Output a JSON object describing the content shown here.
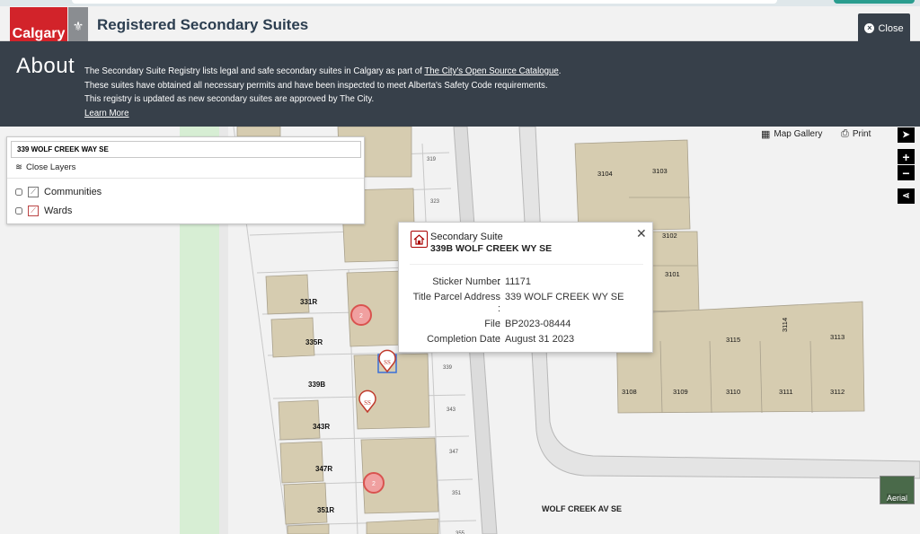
{
  "header": {
    "logo_text": "Calgary",
    "title": "Registered Secondary Suites",
    "close_label": "Close"
  },
  "about": {
    "heading": "About",
    "line1_a": "The Secondary Suite Registry lists legal and safe secondary suites in Calgary as part of ",
    "line1_link": "The City's Open Source Catalogue",
    "line1_b": ".",
    "line2": "These suites have obtained all necessary permits and have been inspected to meet Alberta's Safety Code requirements.",
    "line3": "This registry is updated as new secondary suites are approved by The City.",
    "learn_more": "Learn More"
  },
  "layers": {
    "search_value": "339 WOLF CREEK WAY SE",
    "close_label": "Close Layers",
    "items": [
      {
        "label": "Communities",
        "checked": false
      },
      {
        "label": "Wards",
        "checked": false
      }
    ]
  },
  "toolbar": {
    "map_gallery": "Map Gallery",
    "print": "Print",
    "aerial": "Aerial"
  },
  "popup": {
    "title": "Secondary Suite",
    "subtitle": "339B WOLF CREEK WY SE",
    "sticker_label": "Sticker Number",
    "sticker_value": "11171",
    "title_parcel_label": "Title Parcel Address",
    "title_parcel_value": "339 WOLF CREEK WY SE",
    "file_label": "File",
    "file_value": "BP2023-08444",
    "completion_label": "Completion Date",
    "completion_value": "August 31 2023"
  },
  "map": {
    "street_label": "WOLF CREEK AV SE",
    "lot_labels": [
      "331R",
      "335R",
      "339B",
      "343R",
      "347R",
      "351R"
    ],
    "house_numbers": [
      "319",
      "323",
      "339",
      "343",
      "347",
      "351",
      "355"
    ],
    "building_numbers": [
      "3104",
      "3103",
      "3102",
      "3101",
      "3114",
      "3115",
      "3113",
      "3108",
      "3109",
      "3110",
      "3111",
      "3112"
    ],
    "cluster_counts": [
      "2",
      "2"
    ],
    "suite_marker_label": "SS",
    "partial_label": "5"
  },
  "colors": {
    "brand_red": "#d2232a",
    "header_dark": "#37404a",
    "parcel": "#d6ccb0",
    "green_strip": "#d7eed4",
    "marker_red": "#d9534f"
  }
}
